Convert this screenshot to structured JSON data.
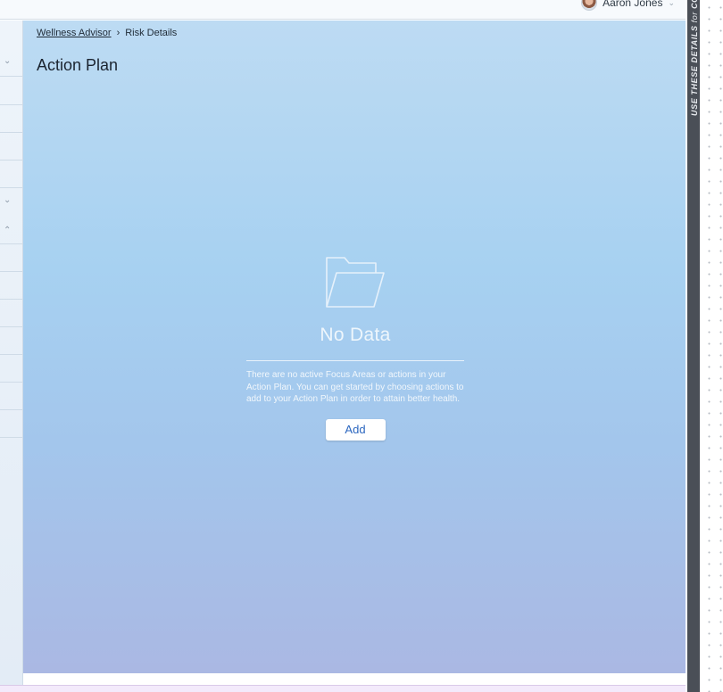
{
  "header": {
    "user_name": "Aaron Jones"
  },
  "breadcrumb": {
    "parent": "Wellness Advisor",
    "current": "Risk Details"
  },
  "page": {
    "title": "Action Plan"
  },
  "empty_state": {
    "heading": "No Data",
    "message": "There are no active Focus Areas or actions in your Action Plan. You can get started by choosing actions to add to your Action Plan in order to attain better health.",
    "add_label": "Add"
  },
  "side_banner": {
    "text": "USE THESE DETAILS",
    "for_word": "for",
    "tail": "CO"
  },
  "icons": {
    "user_chevron": "chevron-down-icon",
    "breadcrumb_separator": "chevron-right-icon",
    "empty_state": "folder-open-icon"
  },
  "colors": {
    "accent": "#2b66bf",
    "panel_top": "#bddbf3",
    "panel_bottom": "#aab8e3",
    "banner": "#4a4f57"
  }
}
